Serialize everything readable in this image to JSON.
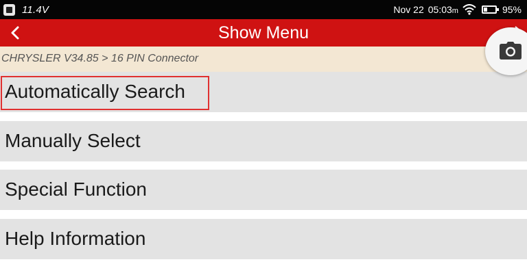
{
  "status_bar": {
    "voltage": "11.4V",
    "date": "Nov 22",
    "time": "05:03",
    "period": "m",
    "battery": "95%"
  },
  "header": {
    "title": "Show Menu"
  },
  "breadcrumb": "CHRYSLER V34.85 > 16 PIN Connector",
  "menu": {
    "items": [
      {
        "label": "Automatically Search"
      },
      {
        "label": "Manually Select"
      },
      {
        "label": "Special Function"
      },
      {
        "label": "Help Information"
      }
    ]
  },
  "colors": {
    "title_bar": "#cf1212",
    "breadcrumb_bg": "#f3e7d3",
    "menu_item_bg": "#e3e3e3",
    "highlight": "#e03030"
  },
  "icons": [
    "app-icon",
    "wifi-icon",
    "battery-icon",
    "back-arrow-icon",
    "camera-icon",
    "share-icon"
  ]
}
